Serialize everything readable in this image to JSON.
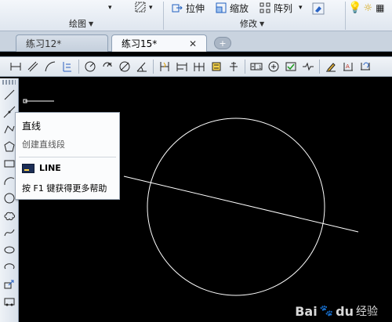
{
  "ribbon": {
    "buttons": {
      "stretch": "拉伸",
      "scale": "缩放",
      "array": "阵列"
    },
    "panels": {
      "draw": "绘图",
      "modify": "修改"
    }
  },
  "tabs": [
    {
      "label": "练习12*",
      "active": false
    },
    {
      "label": "练习15*",
      "active": true
    }
  ],
  "tooltip": {
    "title": "直线",
    "description": "创建直线段",
    "command": "LINE",
    "help": "按 F1 键获得更多帮助"
  },
  "watermark": {
    "brand": "Bai",
    "brand2": "du",
    "suffix": "经验"
  },
  "colors": {
    "canvas": "#000000",
    "ribbon": "#e6ecf3",
    "drawing": "#ffffff"
  }
}
